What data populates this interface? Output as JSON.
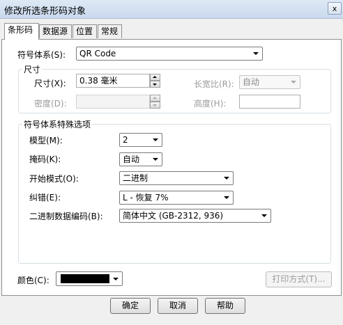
{
  "window": {
    "title": "修改所选条形码对象",
    "close_label": "x"
  },
  "tabs": [
    {
      "label": "条形码",
      "active": true
    },
    {
      "label": "数据源",
      "active": false
    },
    {
      "label": "位置",
      "active": false
    },
    {
      "label": "常规",
      "active": false
    }
  ],
  "symbology": {
    "label": "符号体系(S):",
    "value": "QR Code"
  },
  "size_group": {
    "title": "尺寸",
    "size_label": "尺寸(X):",
    "size_value": "0.38 毫米",
    "aspect_label": "长宽比(R):",
    "aspect_value": "自动",
    "density_label": "密度(D):",
    "density_value": "",
    "height_label": "高度(H):",
    "height_value": ""
  },
  "options_group": {
    "title": "符号体系特殊选项",
    "model_label": "模型(M):",
    "model_value": "2",
    "mask_label": "掩码(K):",
    "mask_value": "自动",
    "start_mode_label": "开始模式(O):",
    "start_mode_value": "二进制",
    "error_label": "纠错(E):",
    "error_value": "L - 恢复 7%",
    "encoding_label": "二进制数据编码(B):",
    "encoding_value": "简体中文 (GB-2312, 936)"
  },
  "color": {
    "label": "颜色(C):",
    "value_hex": "#000000"
  },
  "print_method_label": "打印方式(T)...",
  "buttons": {
    "ok": "确定",
    "cancel": "取消",
    "help": "帮助"
  }
}
